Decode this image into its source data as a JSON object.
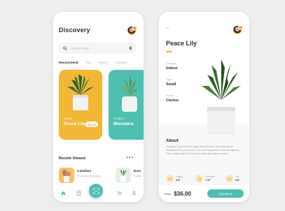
{
  "discovery": {
    "title": "Discovery",
    "search": {
      "placeholder": "Search Plant"
    },
    "tabs": [
      "Recommend",
      "Top",
      "Indoor",
      "Outdoor"
    ],
    "featured": [
      {
        "category": "Indoor",
        "name": "Peace Lily",
        "price": "$36.00",
        "color": "#f2b737"
      },
      {
        "category": "Outdoor",
        "name": "Monstera",
        "color": "#4fbfb0"
      }
    ],
    "recent_title": "Recent Viewed",
    "more_label": "•••",
    "recent": [
      {
        "name": "Calathea",
        "subtitle": "It's spines don't grow"
      },
      {
        "name": "Ears",
        "subtitle": "Locate"
      }
    ],
    "nav_icons": [
      "home-icon",
      "notes-icon",
      "scan-icon",
      "cart-icon",
      "user-icon"
    ]
  },
  "detail": {
    "back_label": "←",
    "title": "Peace Lily",
    "props": [
      {
        "label": "Category",
        "value": "Indoor"
      },
      {
        "label": "Type",
        "value": "Small"
      },
      {
        "label": "Plants",
        "value": "Cactus"
      }
    ],
    "about_title": "About",
    "about_text": "However, they hold the huge white flowers, and they bloom throughout the year (and a lot more frequently in the springtime). This coupled with the plant's broad, deep green leaves",
    "stats": [
      {
        "label": "Height",
        "value": "9.5\""
      },
      {
        "label": "Humidity",
        "value": "+ 37°"
      },
      {
        "label": "Dia",
        "value": "5.8\""
      }
    ],
    "price_label": "Price :",
    "price": "$36.00",
    "checkout_label": "Checkout"
  },
  "colors": {
    "accent_yellow": "#f2b737",
    "accent_teal": "#4fbfb0",
    "text_dark": "#2c2c2c"
  }
}
